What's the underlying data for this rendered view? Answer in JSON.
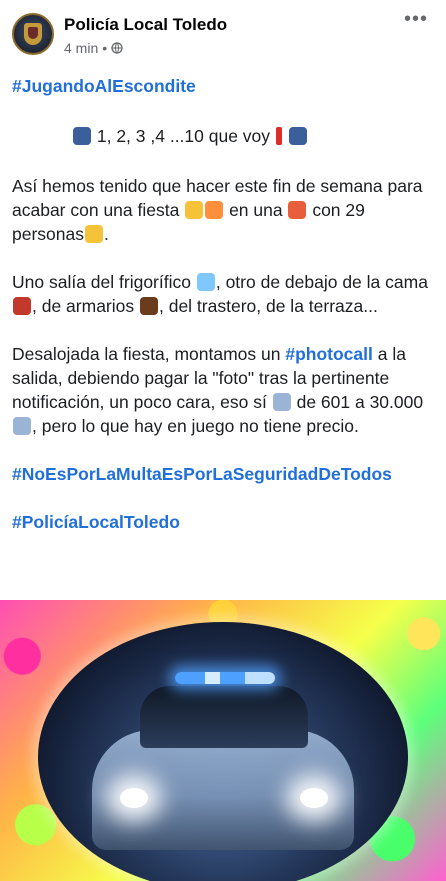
{
  "header": {
    "page_name": "Policía Local Toledo",
    "time": "4 min",
    "separator": "•",
    "more": "•••"
  },
  "post": {
    "hashtag_top": "#JugandoAlEscondite",
    "line_count": " 1, 2,  3 ,4 ...10 que voy",
    "para1": {
      "a": "Así hemos tenido que hacer este fin de semana para acabar con una fiesta ",
      "b": " en una ",
      "c": " con 29 personas"
    },
    "para2": {
      "a": "Uno salía del frigorífico ",
      "b": ", otro de debajo de la cama ",
      "c": ", de armarios ",
      "d": ", del trastero, de la terraza..."
    },
    "para3": {
      "a": "Desalojada la fiesta, montamos un ",
      "hashtag": "#photocall",
      "b": " a la salida, debiendo pagar la \"foto\" tras la pertinente notificación, un poco cara, eso sí ",
      "c": " de 601 a 30.000 ",
      "d": ", pero lo que hay en juego no tiene precio."
    },
    "hashtag_2": "#NoEsPorLaMultaEsPorLaSeguridadDeTodos",
    "hashtag_3": "#PolicíaLocalToledo"
  },
  "icons": {
    "police_officer": "police-officer-emoji",
    "exclamation": "red-exclamation-emoji",
    "party_face": "party-face-emoji",
    "party_popper": "party-popper-emoji",
    "house": "house-emoji",
    "triumph_face": "steam-nose-face-emoji",
    "cold_face": "cold-face-emoji",
    "bed": "bed-emoji",
    "door": "door-emoji",
    "money": "banknotes-emoji",
    "globe": "globe-icon"
  },
  "colors": {
    "hashtag": "#216fdb",
    "text": "#1c1e21",
    "meta": "#65676b"
  }
}
